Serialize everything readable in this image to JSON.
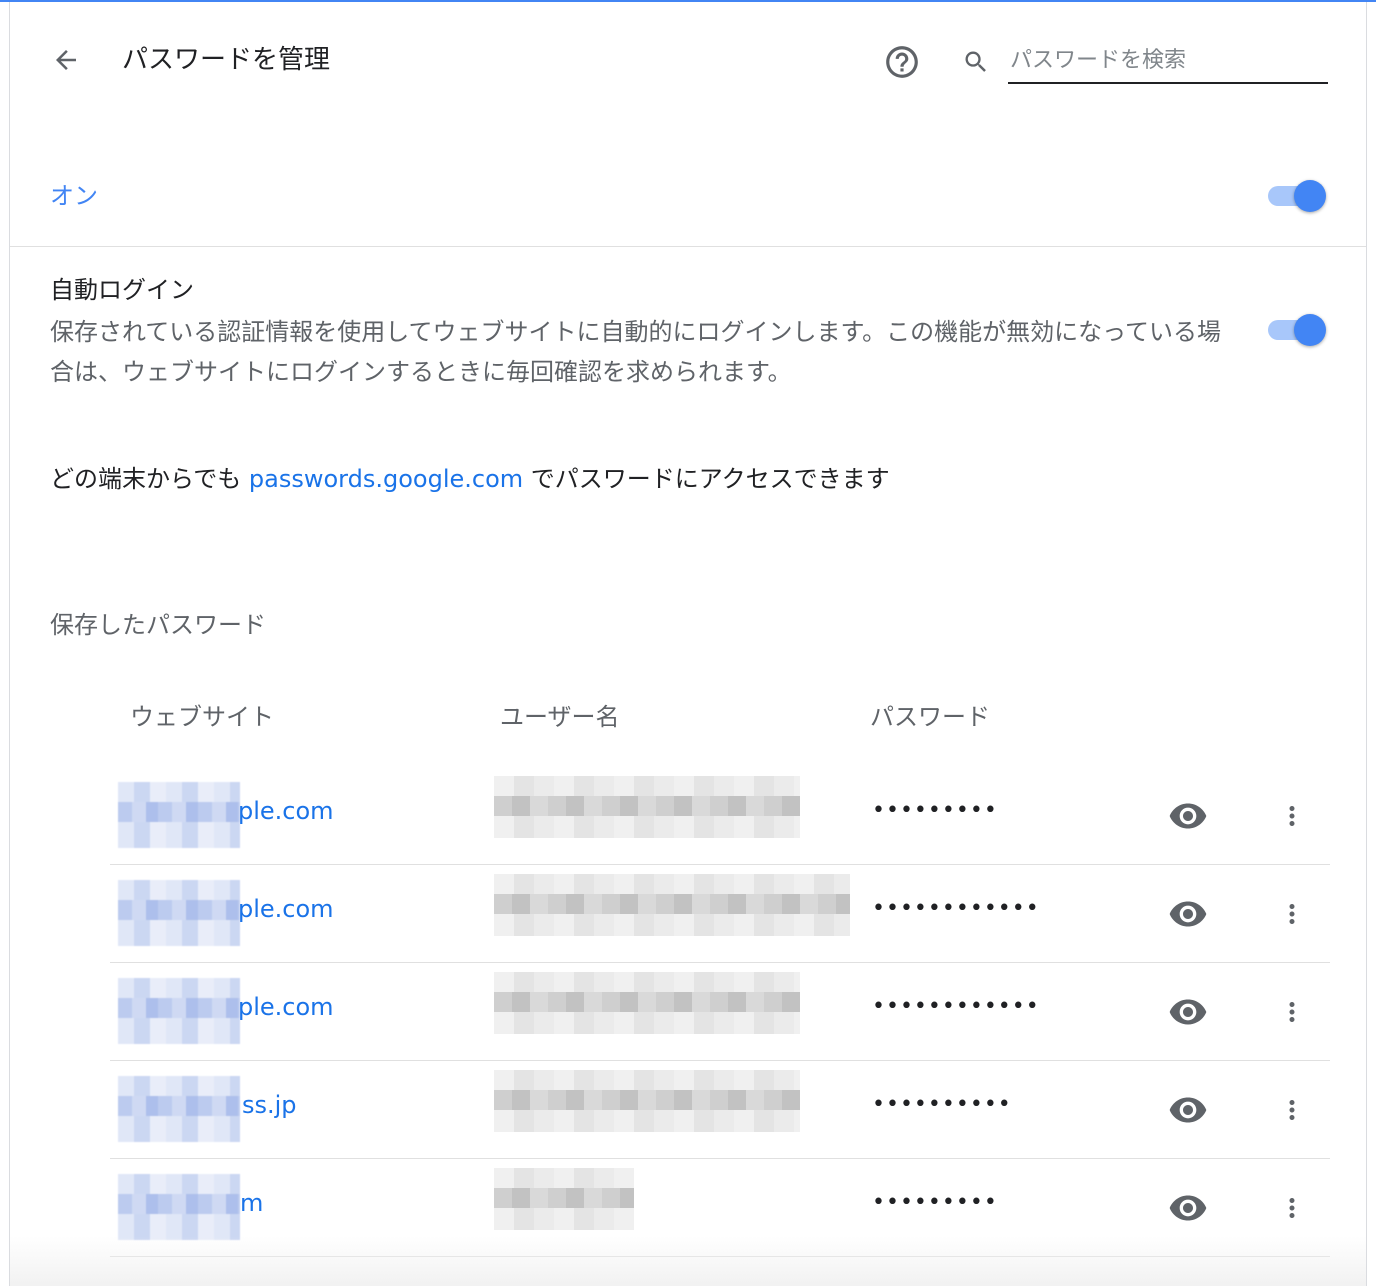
{
  "header": {
    "title": "パスワードを管理",
    "search_placeholder": "パスワードを検索",
    "search_value": ""
  },
  "save_toggle": {
    "label": "オン",
    "state": true
  },
  "auto_login": {
    "title": "自動ログイン",
    "description": "保存されている認証情報を使用してウェブサイトに自動的にログインします。この機能が無効になっている場合は、ウェブサイトにログインするときに毎回確認を求められます。",
    "state": true
  },
  "access": {
    "prefix": "どの端末からでも ",
    "link": "passwords.google.com",
    "suffix": " でパスワードにアクセスできます"
  },
  "saved": {
    "heading": "保存したパスワード",
    "columns": [
      "ウェブサイト",
      "ユーザー名",
      "パスワード"
    ],
    "rows": [
      {
        "site_visible": "ple.com",
        "password_mask": "•••••••••"
      },
      {
        "site_visible": "ple.com",
        "password_mask": "••••••••••••"
      },
      {
        "site_visible": "ple.com",
        "password_mask": "••••••••••••"
      },
      {
        "site_visible": "ss.jp",
        "password_mask": "••••••••••"
      },
      {
        "site_visible": "m",
        "password_mask": "•••••••••"
      }
    ]
  },
  "colors": {
    "accent": "#4285f4",
    "link": "#1a73e8",
    "text": "#202124",
    "secondary": "#5f6368"
  },
  "icons": [
    "back-arrow-icon",
    "help-icon",
    "search-icon",
    "eye-icon",
    "more-vert-icon"
  ]
}
